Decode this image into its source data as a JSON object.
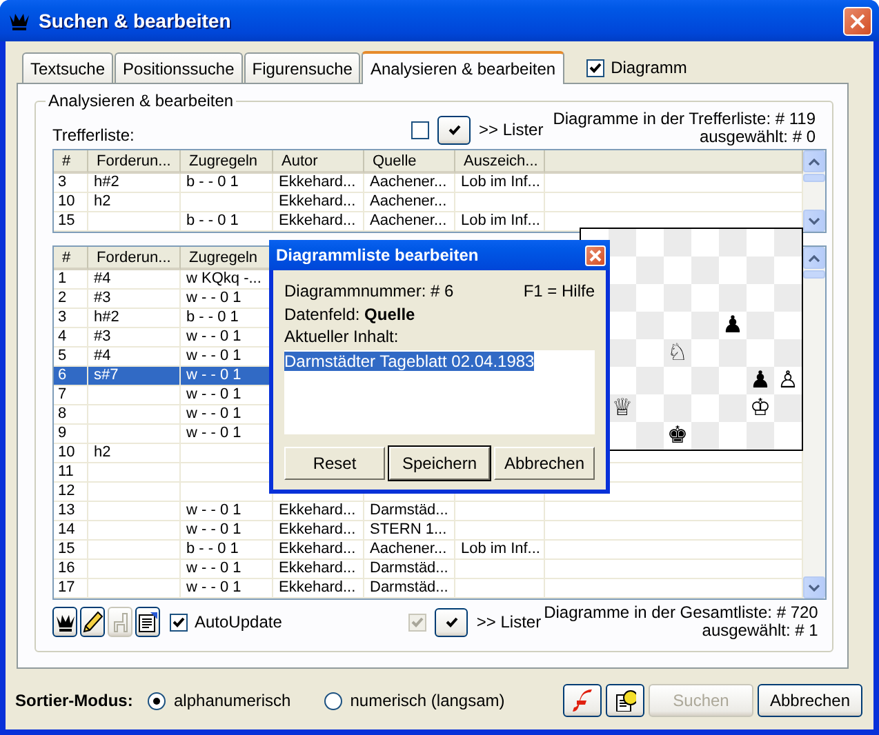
{
  "window": {
    "title": "Suchen & bearbeiten"
  },
  "tabs": [
    {
      "label": "Textsuche",
      "selected": false
    },
    {
      "label": "Positionssuche",
      "selected": false
    },
    {
      "label": "Figurensuche",
      "selected": false
    },
    {
      "label": "Analysieren & bearbeiten",
      "selected": true
    }
  ],
  "diagram_toggle": {
    "label": "Diagramm",
    "checked": true
  },
  "group": {
    "title": "Analysieren & bearbeiten"
  },
  "hit_list": {
    "label": "Trefferliste:",
    "select_checkbox": {
      "checked": false,
      "disabled": false
    },
    "lister_label": ">> Lister",
    "count": "Diagramme in der Trefferliste: # 119",
    "selected_count": "ausgewählt: # 0",
    "columns": [
      "#",
      "Forderun...",
      "Zugregeln",
      "Autor",
      "Quelle",
      "Auszeich..."
    ],
    "rows": [
      {
        "number": "3",
        "stipulation": "h#2",
        "move_rules": "b - - 0 1",
        "author": "Ekkehard...",
        "source": "Aachener...",
        "award": "Lob im Inf...",
        "selected": false
      },
      {
        "number": "10",
        "stipulation": "h2",
        "author": "Ekkehard...",
        "source": "Aachener...",
        "selected": false
      },
      {
        "number": "15",
        "move_rules": "b - - 0 1",
        "author": "Ekkehard...",
        "source": "Aachener...",
        "award": "Lob im Inf...",
        "selected": false
      }
    ]
  },
  "total_list": {
    "columns": [
      "#",
      "Forderun...",
      "Zugregeln"
    ],
    "rows": [
      {
        "number": "1",
        "stipulation": "#4",
        "move_rules": "w KQkq -...",
        "selected": false
      },
      {
        "number": "2",
        "stipulation": "#3",
        "move_rules": "w - - 0 1",
        "selected": false
      },
      {
        "number": "3",
        "stipulation": "h#2",
        "move_rules": "b - - 0 1",
        "selected": false
      },
      {
        "number": "4",
        "stipulation": "#3",
        "move_rules": "w - - 0 1",
        "selected": false
      },
      {
        "number": "5",
        "stipulation": "#4",
        "move_rules": "w - - 0 1",
        "selected": false
      },
      {
        "number": "6",
        "stipulation": "s#7",
        "move_rules": "w - - 0 1",
        "selected": true
      },
      {
        "number": "7",
        "move_rules": "w - - 0 1",
        "selected": false
      },
      {
        "number": "8",
        "move_rules": "w - - 0 1",
        "selected": false
      },
      {
        "number": "9",
        "move_rules": "w - - 0 1",
        "selected": false
      },
      {
        "number": "10",
        "stipulation": "h2",
        "selected": false
      },
      {
        "number": "11",
        "selected": false
      },
      {
        "number": "12",
        "selected": false
      },
      {
        "number": "13",
        "move_rules": "w - - 0 1",
        "author": "Ekkehard...",
        "source": "Darmstäd...",
        "selected": false
      },
      {
        "number": "14",
        "move_rules": "w - - 0 1",
        "author": "Ekkehard...",
        "source": "STERN 1...",
        "selected": false
      },
      {
        "number": "15",
        "move_rules": "b - - 0 1",
        "author": "Ekkehard...",
        "source": "Aachener...",
        "award": "Lob im Inf...",
        "selected": false
      },
      {
        "number": "16",
        "move_rules": "w - - 0 1",
        "author": "Ekkehard...",
        "source": "Darmstäd...",
        "selected": false
      },
      {
        "number": "17",
        "move_rules": "w - - 0 1",
        "author": "Ekkehard...",
        "source": "Darmstäd...",
        "selected": false
      }
    ]
  },
  "board": {
    "ranks": [
      [
        {
          "kind": "empty"
        },
        {
          "kind": "empty"
        },
        {
          "kind": "empty"
        },
        {
          "kind": "empty"
        },
        {
          "kind": "empty"
        },
        {
          "kind": "empty"
        },
        {
          "kind": "empty"
        }
      ],
      [
        {
          "kind": "empty"
        },
        {
          "kind": "empty"
        },
        {
          "kind": "empty"
        },
        {
          "kind": "empty"
        },
        {
          "kind": "empty"
        },
        {
          "kind": "empty"
        },
        {
          "kind": "empty"
        }
      ],
      [
        {
          "kind": "empty"
        },
        {
          "kind": "empty"
        },
        {
          "kind": "empty"
        },
        {
          "kind": "empty"
        },
        {
          "kind": "empty"
        },
        {
          "kind": "empty"
        },
        {
          "kind": "empty"
        }
      ],
      [
        {
          "kind": "empty"
        },
        {
          "kind": "empty"
        },
        {
          "kind": "empty"
        },
        {
          "kind": "empty"
        },
        {
          "kind": "piece",
          "piece": "♟"
        },
        {
          "kind": "empty"
        },
        {
          "kind": "empty"
        }
      ],
      [
        {
          "kind": "empty"
        },
        {
          "kind": "empty"
        },
        {
          "kind": "piece",
          "piece": "♘"
        },
        {
          "kind": "empty"
        },
        {
          "kind": "empty"
        },
        {
          "kind": "empty"
        },
        {
          "kind": "empty"
        }
      ],
      [
        {
          "kind": "empty"
        },
        {
          "kind": "empty"
        },
        {
          "kind": "empty"
        },
        {
          "kind": "empty"
        },
        {
          "kind": "empty"
        },
        {
          "kind": "piece",
          "piece": "♟"
        },
        {
          "kind": "piece",
          "piece": "♙"
        }
      ],
      [
        {
          "kind": "piece",
          "piece": "♕"
        },
        {
          "kind": "empty"
        },
        {
          "kind": "empty"
        },
        {
          "kind": "empty"
        },
        {
          "kind": "empty"
        },
        {
          "kind": "piece",
          "piece": "♔"
        },
        {
          "kind": "empty"
        }
      ],
      [
        {
          "kind": "empty"
        },
        {
          "kind": "empty"
        },
        {
          "kind": "piece",
          "piece": "♚"
        },
        {
          "kind": "empty"
        },
        {
          "kind": "empty"
        },
        {
          "kind": "empty"
        },
        {
          "kind": "empty"
        }
      ]
    ]
  },
  "dialog": {
    "title": "Diagrammliste bearbeiten",
    "number": "Diagrammnummer: # 6",
    "help": "F1 = Hilfe",
    "field": "Datenfeld: **Quelle**",
    "content_label": "Aktueller Inhalt:",
    "content": {
      "value": "Darmstädter Tageblatt 02.04.1983",
      "selected": true
    },
    "buttons": [
      {
        "label": "Reset",
        "default": false
      },
      {
        "label": "Speichern",
        "default": true
      },
      {
        "label": "Abbrechen",
        "default": false
      }
    ]
  },
  "toolbar": {
    "tools": [
      {
        "kind": "crown",
        "disabled": false
      },
      {
        "kind": "pencil",
        "disabled": false
      },
      {
        "kind": "chair",
        "disabled": true
      },
      {
        "kind": "properties",
        "disabled": false
      }
    ],
    "auto_update": {
      "label": "AutoUpdate",
      "checked": true
    },
    "select_checkbox": {
      "checked": true,
      "disabled": true
    },
    "lister_label": ">> Lister",
    "count": "Diagramme in der Gesamtliste: # 720",
    "selected_count": "ausgewählt: # 1"
  },
  "sort_mode": {
    "label": "Sortier-Modus:",
    "options": [
      {
        "label": "alphanumerisch",
        "selected": true
      },
      {
        "label": "numerisch (langsam)",
        "selected": false
      }
    ]
  },
  "buttons": [
    {
      "kind": "flash",
      "disabled": false
    },
    {
      "kind": "help",
      "disabled": false
    },
    {
      "kind": "text",
      "label": "Suchen",
      "disabled": true
    },
    {
      "kind": "text",
      "label": "Abbrechen",
      "disabled": false
    }
  ]
}
